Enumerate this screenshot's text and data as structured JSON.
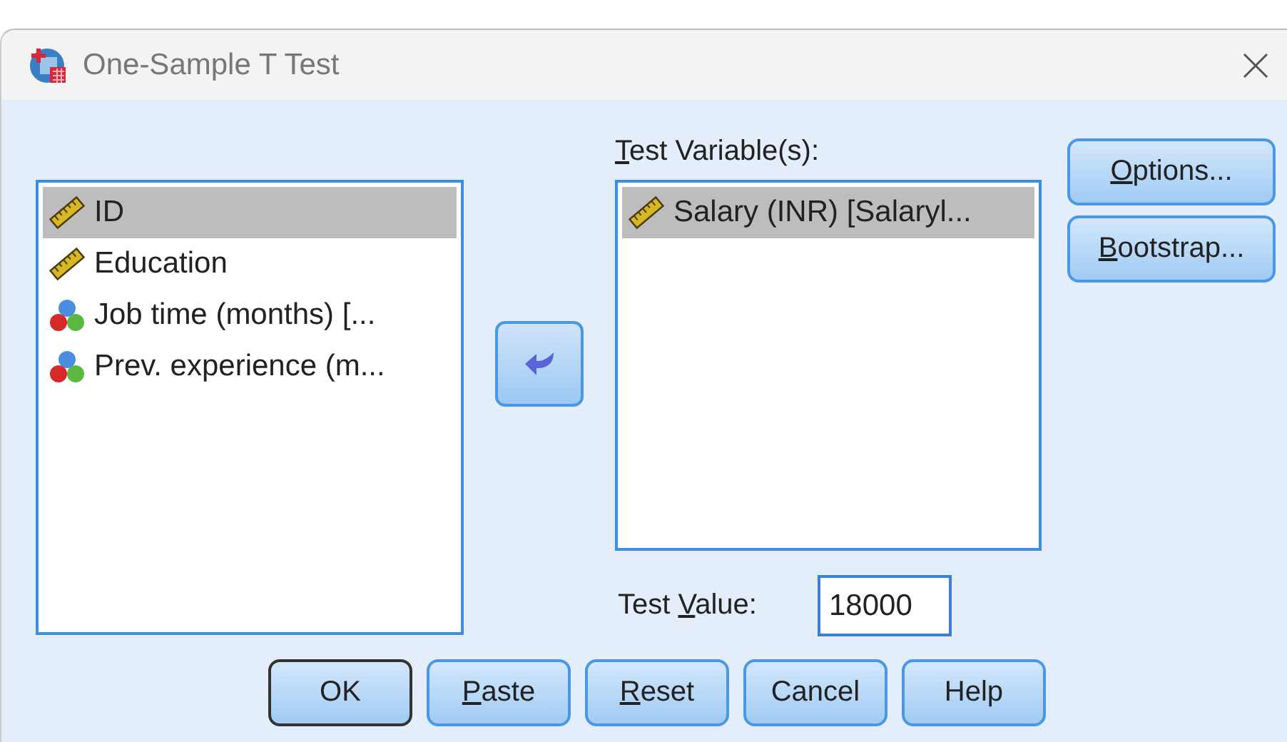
{
  "window": {
    "title": "One-Sample T Test"
  },
  "source_list": {
    "items": [
      {
        "label": "ID",
        "kind": "scale",
        "selected": true
      },
      {
        "label": "Education",
        "kind": "scale",
        "selected": false
      },
      {
        "label": "Job time (months) [...",
        "kind": "nominal",
        "selected": false
      },
      {
        "label": "Prev. experience (m...",
        "kind": "nominal",
        "selected": false
      }
    ]
  },
  "test_variables": {
    "label": [
      {
        "text": "T",
        "underlined": true
      },
      {
        "text": "est Variable(s):",
        "underlined": false
      }
    ],
    "items": [
      {
        "label": "Salary (INR) [Salaryl...",
        "kind": "scale",
        "selected": true
      }
    ]
  },
  "side_buttons": [
    {
      "label": [
        {
          "text": "O",
          "underlined": true
        },
        {
          "text": "ptions...",
          "underlined": false
        }
      ]
    },
    {
      "label": [
        {
          "text": "B",
          "underlined": true
        },
        {
          "text": "ootstrap...",
          "underlined": false
        }
      ]
    }
  ],
  "test_value": {
    "label": [
      {
        "text": "Test ",
        "underlined": false
      },
      {
        "text": "V",
        "underlined": true
      },
      {
        "text": "alue:",
        "underlined": false
      }
    ],
    "value": "18000"
  },
  "buttons": [
    {
      "label": [
        {
          "text": "OK",
          "underlined": false
        }
      ],
      "default": true
    },
    {
      "label": [
        {
          "text": "P",
          "underlined": true
        },
        {
          "text": "aste",
          "underlined": false
        }
      ],
      "default": false
    },
    {
      "label": [
        {
          "text": "R",
          "underlined": true
        },
        {
          "text": "eset",
          "underlined": false
        }
      ],
      "default": false
    },
    {
      "label": [
        {
          "text": "Cancel",
          "underlined": false
        }
      ],
      "default": false
    },
    {
      "label": [
        {
          "text": "Help",
          "underlined": false
        }
      ],
      "default": false
    }
  ]
}
